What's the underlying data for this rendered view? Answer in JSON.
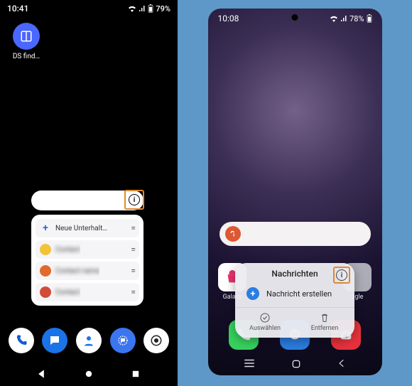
{
  "left": {
    "status": {
      "time": "10:41",
      "battery": "79%",
      "battery_icon": "battery-icon",
      "signal_icon": "signal-icon",
      "wifi_icon": "wifi-icon"
    },
    "home_app": {
      "label": "DS find…",
      "icon": "ds-find-icon"
    },
    "widget": {
      "info_icon": "info-icon",
      "new_row": {
        "label": "Neue Unterhalt…",
        "icon": "plus-icon"
      },
      "rows": [
        {
          "avatar_color": "#f2c23b",
          "label": "Contact"
        },
        {
          "avatar_color": "#e06a2c",
          "label": "Contact name"
        },
        {
          "avatar_color": "#d14b3a",
          "label": "Contact"
        }
      ]
    },
    "dock": [
      {
        "name": "phone-icon",
        "bg": "#ffffff",
        "fg": "#1558d6"
      },
      {
        "name": "messages-icon",
        "bg": "#1a73e8",
        "fg": "#ffffff"
      },
      {
        "name": "contacts-icon",
        "bg": "#ffffff",
        "fg": "#1a73e8"
      },
      {
        "name": "signal-app-icon",
        "bg": "#3a76f0",
        "fg": "#ffffff"
      },
      {
        "name": "camera-icon",
        "bg": "#ffffff",
        "fg": "#222222"
      }
    ],
    "nav": {
      "back": "◀",
      "home": "●",
      "recent": "■"
    }
  },
  "right": {
    "status": {
      "time": "10:08",
      "battery": "78%",
      "battery_icon": "battery-icon",
      "signal_icon": "signal-icon",
      "wifi_icon": "wifi-icon",
      "lock_icon": "lock-icon"
    },
    "search": {
      "engine_icon": "duckduckgo-icon",
      "placeholder": ""
    },
    "app_row": [
      {
        "name": "galaxy-store-icon",
        "label": "Galaxy",
        "bg": "#ffffff"
      },
      {
        "name": "app-icon",
        "label": "",
        "bg": "transparent"
      },
      {
        "name": "app-icon",
        "label": "",
        "bg": "transparent"
      },
      {
        "name": "google-folder-icon",
        "label": "ogle",
        "bg": "#cfd3d8"
      }
    ],
    "popup": {
      "title": "Nachrichten",
      "info_icon": "info-icon",
      "compose": {
        "label": "Nachricht erstellen",
        "icon": "plus-icon"
      },
      "actions": [
        {
          "label": "Auswählen",
          "icon": "check-circle-icon"
        },
        {
          "label": "Entfernen",
          "icon": "trash-icon"
        }
      ]
    },
    "dock": [
      {
        "name": "phone-icon",
        "bg": "#36d15e"
      },
      {
        "name": "messages-icon",
        "bg": "#2a7de1"
      },
      {
        "name": "camera-icon",
        "bg": "#e7323c"
      }
    ],
    "nav": {
      "recent": "recent-icon",
      "home": "home-icon",
      "back": "back-icon"
    }
  }
}
